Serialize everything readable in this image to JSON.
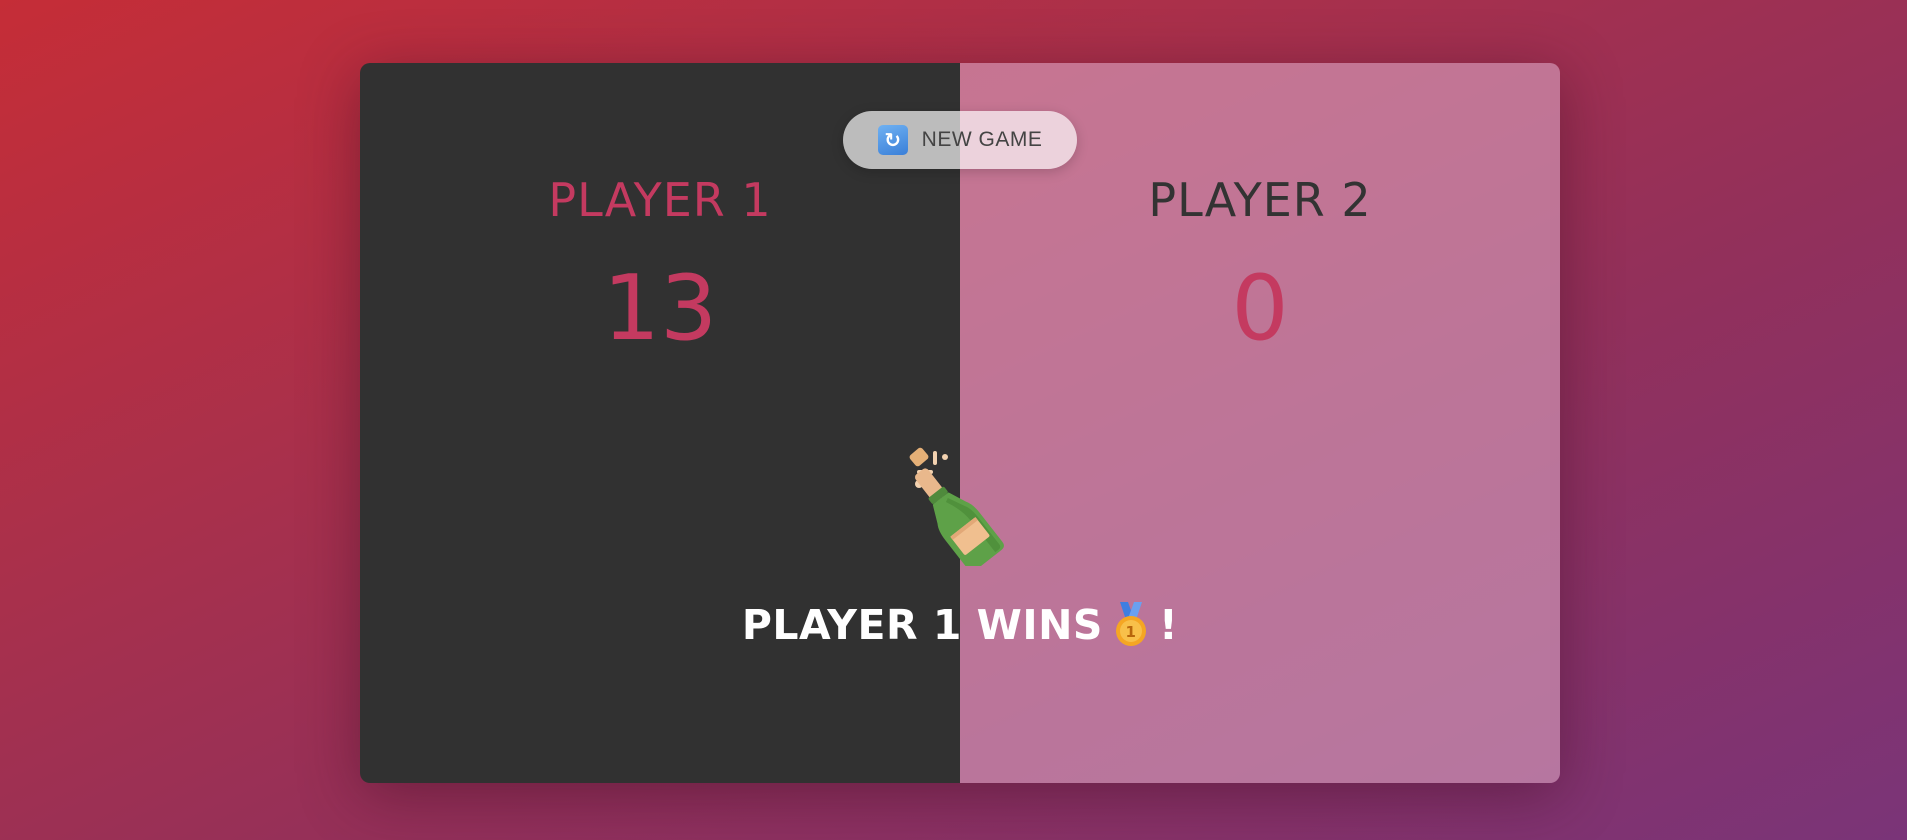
{
  "toolbar": {
    "new_game_label": "NEW GAME",
    "new_game_icon": "refresh-icon"
  },
  "players": [
    {
      "name": "PLAYER 1",
      "score": "13"
    },
    {
      "name": "PLAYER 2",
      "score": "0"
    }
  ],
  "result": {
    "text": "PLAYER 1 WINS",
    "suffix": "!",
    "medal_icon": "first-place-medal-icon",
    "celebration_icon": "champagne-bottle-icon"
  },
  "colors": {
    "accent": "#c43a60",
    "left_panel": "#313131",
    "right_panel": "#d7a0be"
  }
}
